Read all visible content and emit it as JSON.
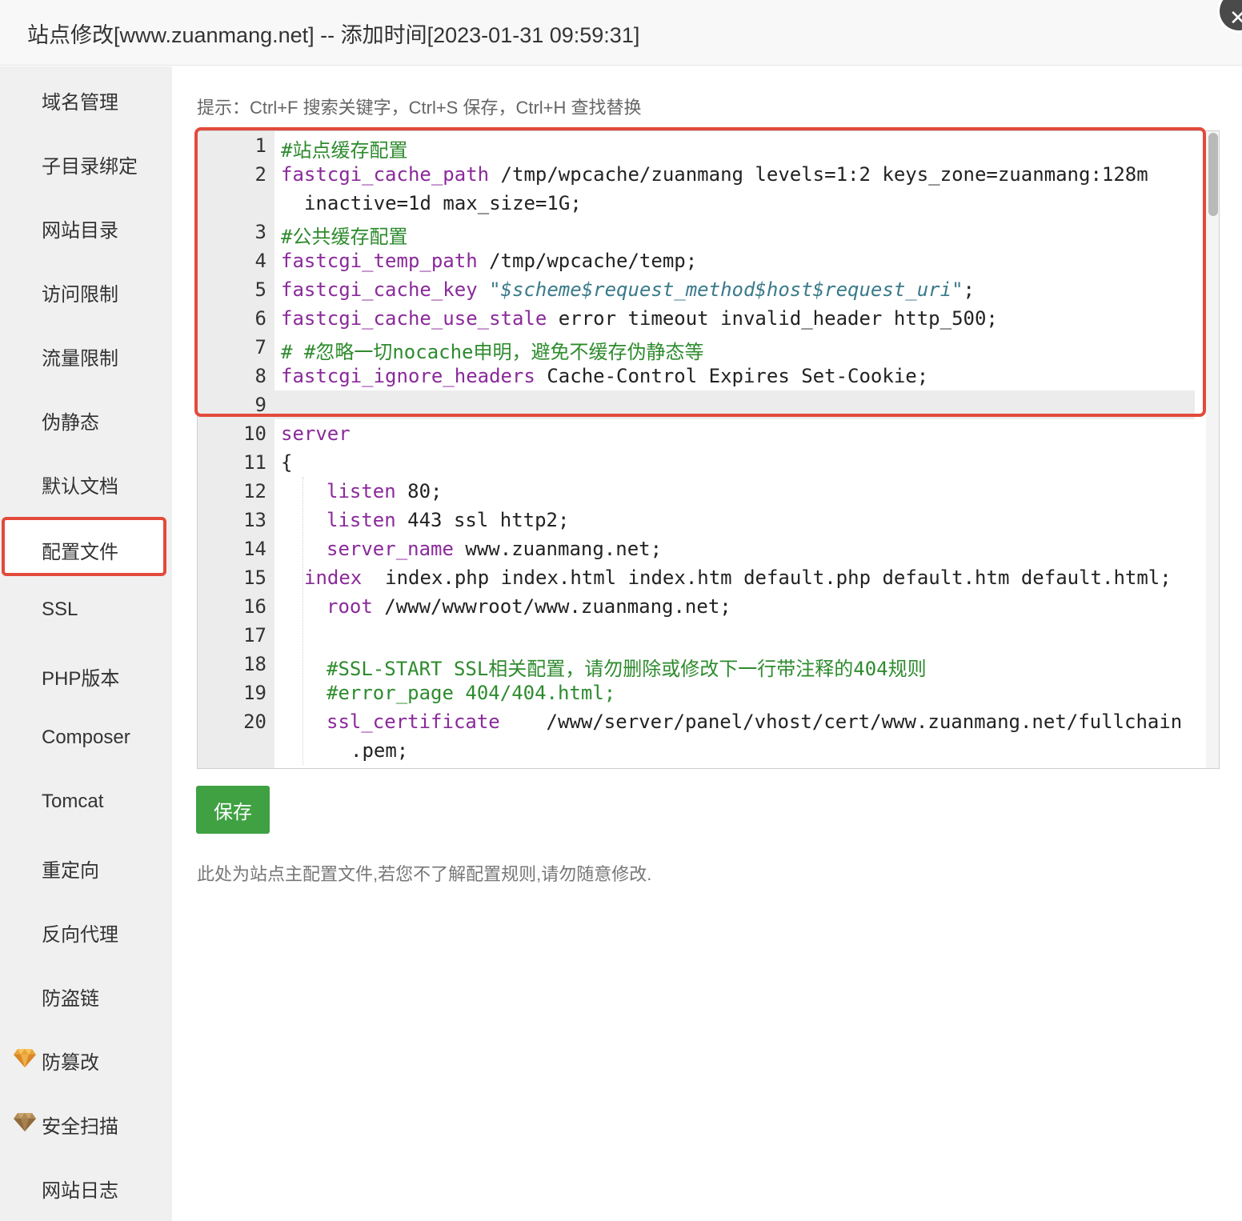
{
  "window": {
    "title": "站点修改[www.zuanmang.net] -- 添加时间[2023-01-31 09:59:31]",
    "close_glyph": "✕"
  },
  "sidebar": {
    "items": [
      {
        "label": "域名管理"
      },
      {
        "label": "子目录绑定"
      },
      {
        "label": "网站目录"
      },
      {
        "label": "访问限制"
      },
      {
        "label": "流量限制"
      },
      {
        "label": "伪静态"
      },
      {
        "label": "默认文档"
      },
      {
        "label": "配置文件",
        "active": true
      },
      {
        "label": "SSL"
      },
      {
        "label": "PHP版本"
      },
      {
        "label": "Composer"
      },
      {
        "label": "Tomcat"
      },
      {
        "label": "重定向"
      },
      {
        "label": "反向代理"
      },
      {
        "label": "防盗链"
      },
      {
        "label": "防篡改",
        "icon": "gem-icon"
      },
      {
        "label": "安全扫描",
        "icon": "gem-icon"
      },
      {
        "label": "网站日志"
      }
    ]
  },
  "hint": "提示：Ctrl+F 搜索关键字，Ctrl+S 保存，Ctrl+H 查找替换",
  "editor": {
    "line_numbers": [
      "1",
      "2",
      "3",
      "4",
      "5",
      "6",
      "7",
      "8",
      "9",
      "10",
      "11",
      "12",
      "13",
      "14",
      "15",
      "16",
      "17",
      "18",
      "19",
      "20"
    ],
    "lines": {
      "l1": {
        "comment": "#站点缓存配置"
      },
      "l2": {
        "directive": "fastcgi_cache_path",
        "args": " /tmp/wpcache/zuanmang levels=1:2 keys_zone=zuanmang:128m",
        "cont": "inactive=1d max_size=1G;"
      },
      "l3": {
        "comment": "#公共缓存配置"
      },
      "l4": {
        "directive": "fastcgi_temp_path",
        "args": " /tmp/wpcache/temp;"
      },
      "l5": {
        "directive": "fastcgi_cache_key",
        "q1": " \"",
        "str": "$scheme$request_method$host$request_uri",
        "q2": "\"",
        "end": ";"
      },
      "l6": {
        "directive": "fastcgi_cache_use_stale",
        "args": " error timeout invalid_header http_500;"
      },
      "l7": {
        "comment": "# #忽略一切nocache申明，避免不缓存伪静态等"
      },
      "l8": {
        "directive": "fastcgi_ignore_headers",
        "args": " Cache-Control Expires Set-Cookie;"
      },
      "l9": {
        "text": ""
      },
      "l10": {
        "directive": "server"
      },
      "l11": {
        "text": "{"
      },
      "l12": {
        "directive": "listen",
        "args": " 80;"
      },
      "l13": {
        "directive": "listen",
        "args": " 443 ssl http2;"
      },
      "l14": {
        "directive": "server_name",
        "args": " www.zuanmang.net;"
      },
      "l15": {
        "directive": "index",
        "args": "  index.php index.html index.htm default.php default.htm default.html;"
      },
      "l16": {
        "directive": "root",
        "args": " /www/wwwroot/www.zuanmang.net;"
      },
      "l17": {
        "text": ""
      },
      "l18": {
        "comment": "#SSL-START SSL相关配置，请勿删除或修改下一行带注释的404规则"
      },
      "l19": {
        "comment": "#error_page 404/404.html;"
      },
      "l20": {
        "directive": "ssl_certificate",
        "args": "    /www/server/panel/vhost/cert/www.zuanmang.net/fullchain",
        "cont": ".pem;"
      }
    }
  },
  "save_button": "保存",
  "note": "此处为站点主配置文件,若您不了解配置规则,请勿随意修改.",
  "colors": {
    "highlight": "#e24a3b",
    "save_green": "#3fa142",
    "comment": "#2e8b2e",
    "keyword": "#8a2a9a",
    "string": "#3a7a8a"
  }
}
